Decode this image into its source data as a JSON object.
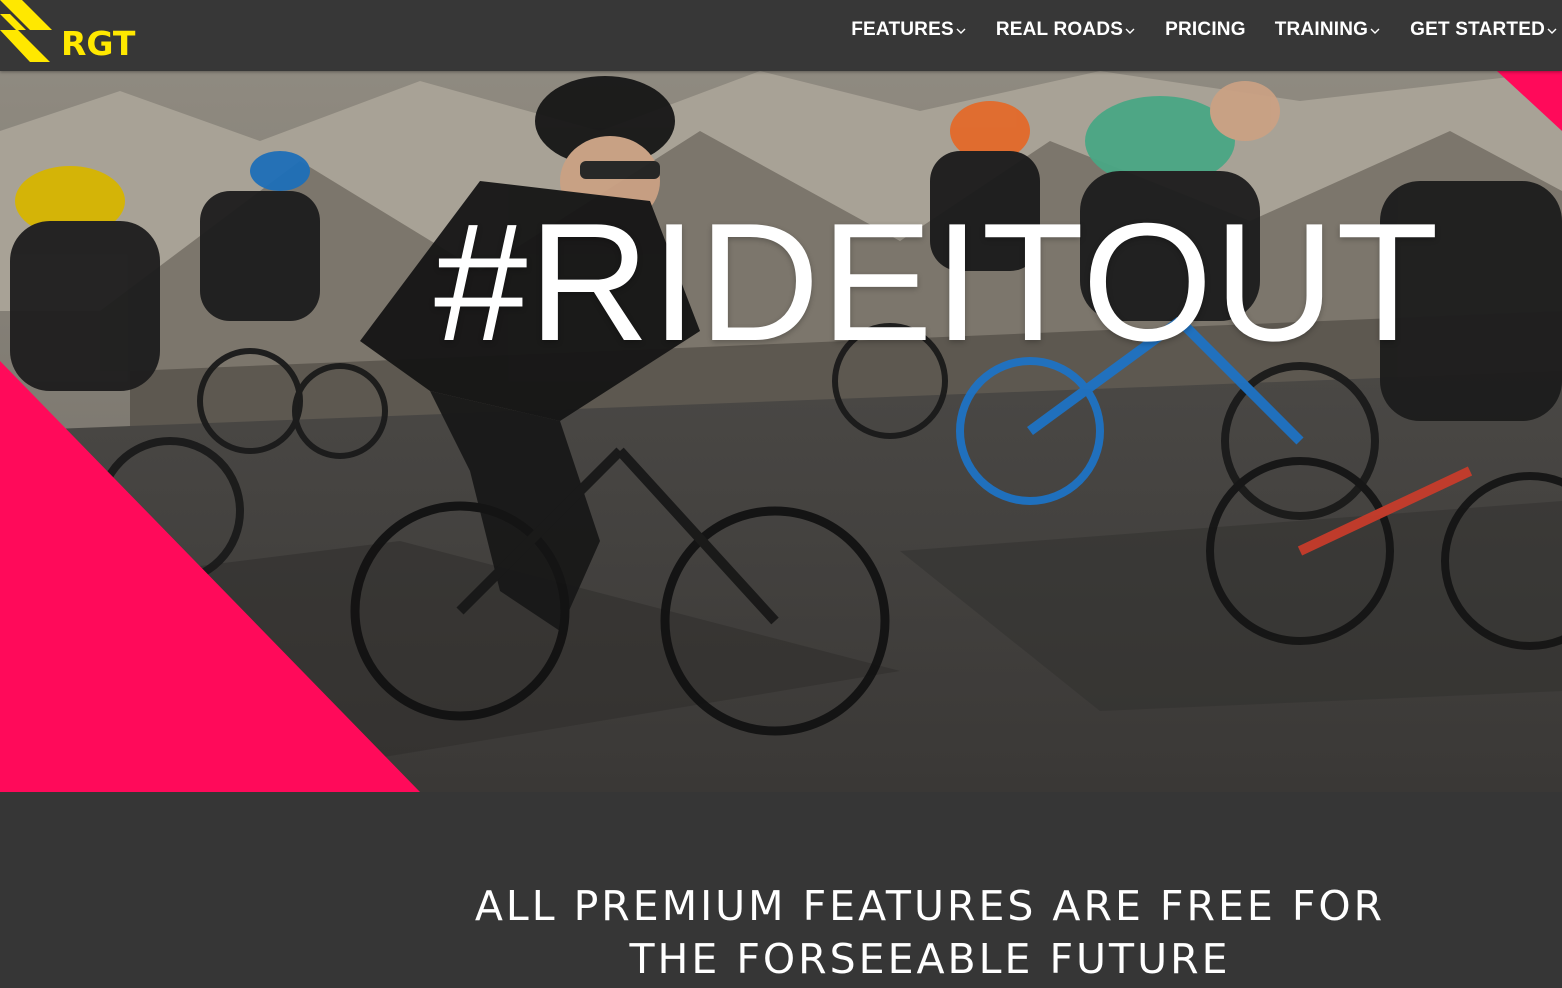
{
  "brand": {
    "name": "RGT",
    "logo_color": "#ffe800"
  },
  "nav": {
    "items": [
      {
        "label": "FEATURES",
        "has_dropdown": true
      },
      {
        "label": "REAL ROADS",
        "has_dropdown": true
      },
      {
        "label": "PRICING",
        "has_dropdown": false
      },
      {
        "label": "TRAINING",
        "has_dropdown": true
      },
      {
        "label": "GET STARTED",
        "has_dropdown": true
      }
    ]
  },
  "hero": {
    "title": "#RIDEITOUT",
    "accent_color": "#ff0a5a"
  },
  "announcement": {
    "line1": "ALL PREMIUM FEATURES ARE FREE FOR",
    "line2": "THE FORSEEABLE FUTURE"
  },
  "colors": {
    "header_bg": "#373737",
    "section_bg": "#363636",
    "text": "#ffffff"
  }
}
